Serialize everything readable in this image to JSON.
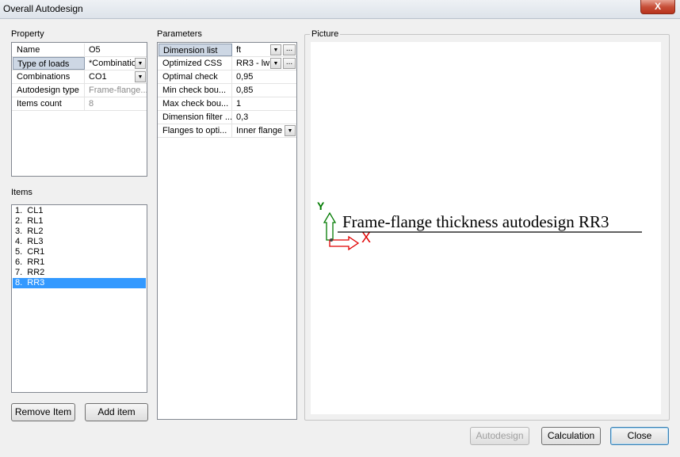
{
  "window": {
    "title": "Overall Autodesign",
    "close_glyph": "X"
  },
  "property": {
    "label": "Property",
    "rows": [
      {
        "name": "Name",
        "value": "O5",
        "dropdown": false,
        "gray": false,
        "selected": false
      },
      {
        "name": "Type of loads",
        "value": "*Combinatioı",
        "dropdown": true,
        "gray": false,
        "selected": true
      },
      {
        "name": "Combinations",
        "value": "CO1",
        "dropdown": true,
        "gray": false,
        "selected": false
      },
      {
        "name": "Autodesign type",
        "value": "Frame-flange...",
        "dropdown": false,
        "gray": true,
        "selected": false
      },
      {
        "name": "Items count",
        "value": "8",
        "dropdown": false,
        "gray": true,
        "selected": false
      }
    ]
  },
  "items": {
    "label": "Items",
    "list": [
      "1.  CL1",
      "2.  RL1",
      "3.  RL2",
      "4.  RL3",
      "5.  CR1",
      "6.  RR1",
      "7.  RR2",
      "8.  RR3"
    ],
    "selected_index": 7,
    "remove_label": "Remove Item",
    "add_label": "Add item"
  },
  "parameters": {
    "label": "Parameters",
    "rows": [
      {
        "name": "Dimension list",
        "value": "ft",
        "control": "dropdown-dots",
        "selected": true
      },
      {
        "name": "Optimized CSS",
        "value": "RR3 - lw",
        "control": "dropdown-dots",
        "selected": false
      },
      {
        "name": "Optimal check",
        "value": "0,95",
        "control": "none",
        "selected": false
      },
      {
        "name": "Min check bou...",
        "value": "0,85",
        "control": "none",
        "selected": false
      },
      {
        "name": "Max check bou...",
        "value": "1",
        "control": "none",
        "selected": false
      },
      {
        "name": "Dimension filter ...",
        "value": "0,3",
        "control": "none",
        "selected": false
      },
      {
        "name": "Flanges to opti...",
        "value": "Inner flange",
        "control": "dropdown",
        "selected": false
      }
    ]
  },
  "picture": {
    "label": "Picture",
    "caption": "Frame-flange thickness autodesign RR3",
    "axis_y_label": "Y",
    "axis_x_label": "X",
    "axis_y_color": "#007a00",
    "axis_x_color": "#e00000"
  },
  "footer": {
    "autodesign_label": "Autodesign",
    "calculation_label": "Calculation",
    "close_label": "Close"
  }
}
